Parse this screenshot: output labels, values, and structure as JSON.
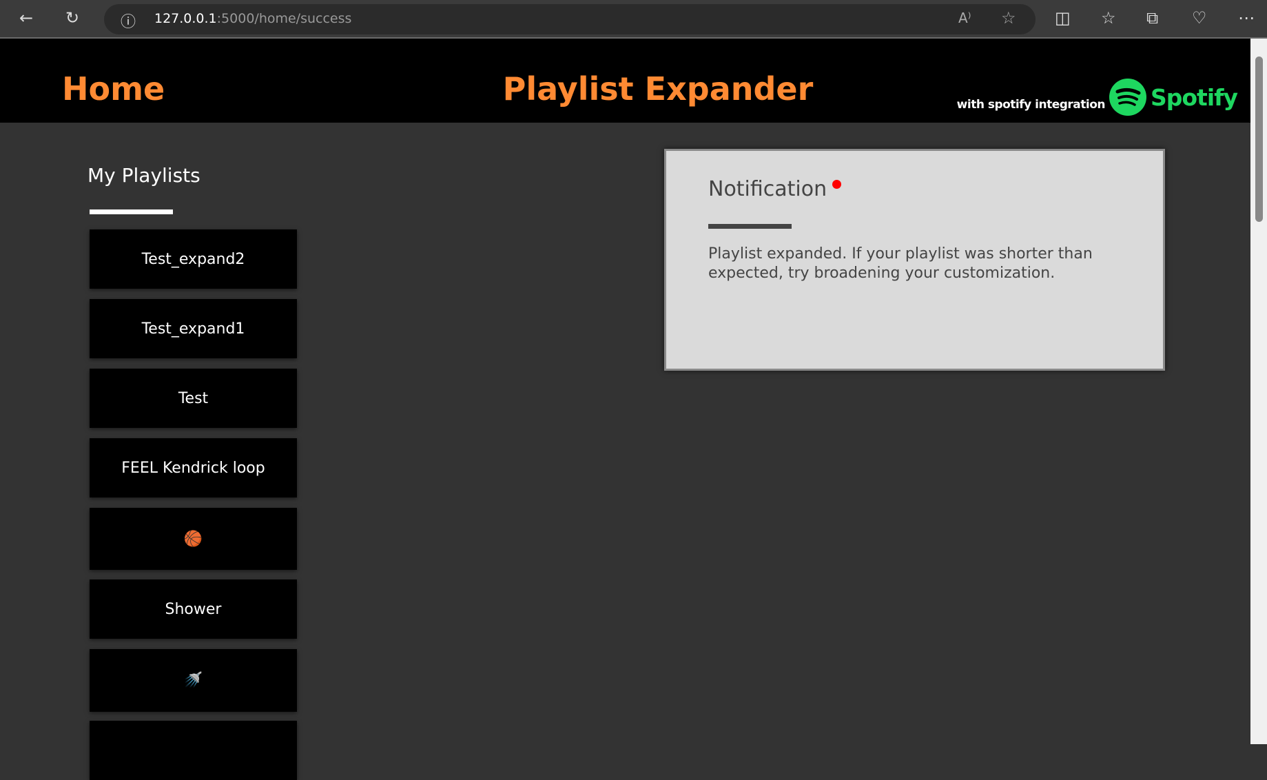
{
  "browser": {
    "url_host": "127.0.0.1",
    "url_path": ":5000/home/success"
  },
  "header": {
    "home": "Home",
    "title": "Playlist Expander",
    "integration": "with spotify integration",
    "spotify_logo": "Spotify",
    "accent": "#ff8a33"
  },
  "sidebar": {
    "heading": "My Playlists",
    "playlists": [
      {
        "label": "Test_expand2"
      },
      {
        "label": "Test_expand1"
      },
      {
        "label": "Test"
      },
      {
        "label": "FEEL Kendrick loop"
      },
      {
        "label": "🏀"
      },
      {
        "label": "Shower"
      },
      {
        "label": "🚿"
      },
      {
        "label": ""
      }
    ]
  },
  "notification": {
    "title": "Notification",
    "message": "Playlist expanded. If your playlist was shorter than expected, try broadening your customization."
  }
}
